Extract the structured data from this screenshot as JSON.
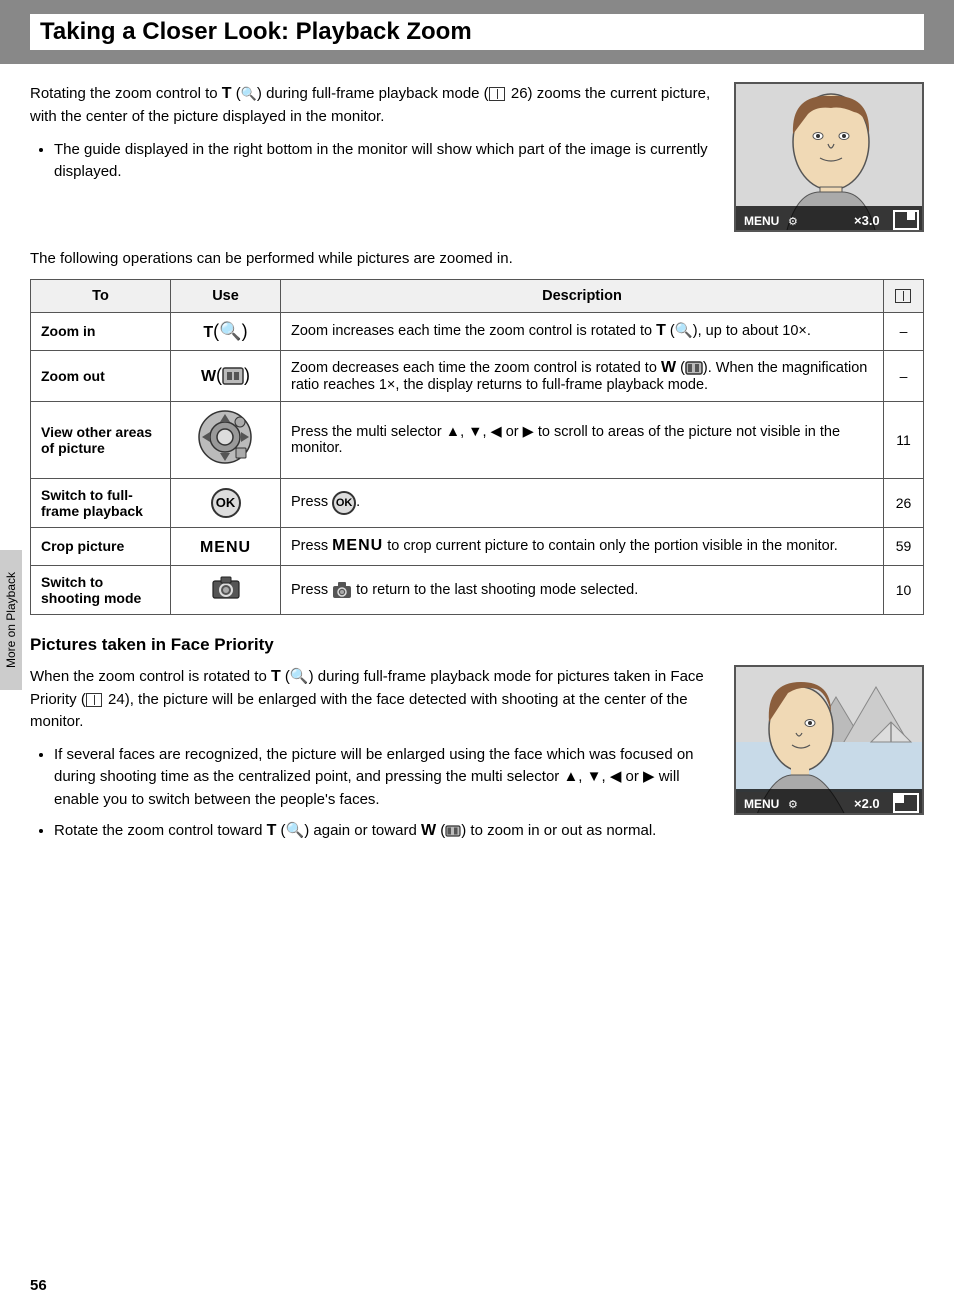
{
  "header": {
    "title": "Taking a Closer Look: Playback Zoom"
  },
  "intro": {
    "paragraph": "Rotating the zoom control to T (🔍) during full-frame playback mode (📖 26) zooms the current picture, with the center of the picture displayed in the monitor.",
    "bullet": "The guide displayed in the right bottom in the monitor will show which part of the image is currently displayed.",
    "following": "The following operations can be performed while pictures are zoomed in."
  },
  "table": {
    "headers": [
      "To",
      "Use",
      "Description",
      "📖"
    ],
    "rows": [
      {
        "to": "Zoom in",
        "use": "T(Q)",
        "description": "Zoom increases each time the zoom control is rotated to T (🔍), up to about 10×.",
        "ref": "–"
      },
      {
        "to": "Zoom out",
        "use": "W(▣)",
        "description": "Zoom decreases each time the zoom control is rotated to W (▣). When the magnification ratio reaches 1×, the display returns to full-frame playback mode.",
        "ref": "–"
      },
      {
        "to": "View other areas of picture",
        "use": "multi-selector",
        "description": "Press the multi selector ▲, ▼, ◄ or ► to scroll to areas of the picture not visible in the monitor.",
        "ref": "11"
      },
      {
        "to": "Switch to full-frame playback",
        "use": "ok",
        "description": "Press ⒪.",
        "ref": "26"
      },
      {
        "to": "Crop picture",
        "use": "MENU",
        "description": "Press MENU to crop current picture to contain only the portion visible in the monitor.",
        "ref": "59"
      },
      {
        "to": "Switch to shooting mode",
        "use": "camera",
        "description": "Press 📷 to return to the last shooting mode selected.",
        "ref": "10"
      }
    ]
  },
  "face_priority": {
    "title": "Pictures taken in Face Priority",
    "paragraph1": "When the zoom control is rotated to T (🔍) during full-frame playback mode for pictures taken in Face Priority (📖 24), the picture will be enlarged with the face detected with shooting at the center of the monitor.",
    "bullets": [
      "If several faces are recognized, the picture will be enlarged using the face which was focused on during shooting time as the centralized point, and pressing the multi selector ▲, ▼, ◄ or ► will enable you to switch between the people’s faces.",
      "Rotate the zoom control toward T (🔍) again or toward W (▣) to zoom in or out as normal."
    ]
  },
  "sidebar": {
    "label": "More on Playback"
  },
  "page_number": "56",
  "zoom_top": "×3.0",
  "zoom_bottom": "×2.0"
}
